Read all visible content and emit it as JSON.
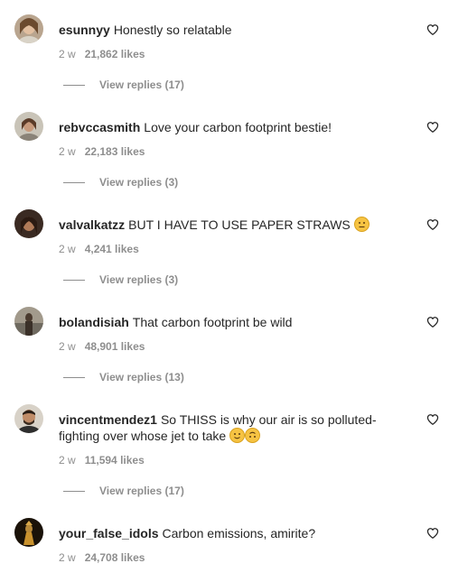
{
  "colors": {
    "text": "#262626",
    "muted": "#8e8e8e",
    "background": "#ffffff"
  },
  "icons": {
    "like": "heart-outline-icon",
    "emoji_neutral": "neutral-face-emoji",
    "emoji_slight_smile": "slight-smile-emoji",
    "emoji_upside_down": "upside-down-face-emoji"
  },
  "comments": [
    {
      "username": "esunnyy",
      "text": "Honestly so relatable",
      "age": "2 w",
      "likes": "21,862 likes",
      "replies": "View replies (17)"
    },
    {
      "username": "rebvccasmith",
      "text": "Love your carbon footprint bestie!",
      "age": "2 w",
      "likes": "22,183 likes",
      "replies": "View replies (3)"
    },
    {
      "username": "valvalkatzz",
      "text": "BUT I HAVE TO USE PAPER STRAWS",
      "age": "2 w",
      "likes": "4,241 likes",
      "replies": "View replies (3)"
    },
    {
      "username": "bolandisiah",
      "text": "That carbon footprint be wild",
      "age": "2 w",
      "likes": "48,901 likes",
      "replies": "View replies (13)"
    },
    {
      "username": "vincentmendez1",
      "text": "So THISS is why our air is so polluted- fighting over whose jet to take",
      "age": "2 w",
      "likes": "11,594 likes",
      "replies": "View replies (17)"
    },
    {
      "username": "your_false_idols",
      "text": "Carbon emissions, amirite?",
      "age": "2 w",
      "likes": "24,708 likes"
    }
  ]
}
